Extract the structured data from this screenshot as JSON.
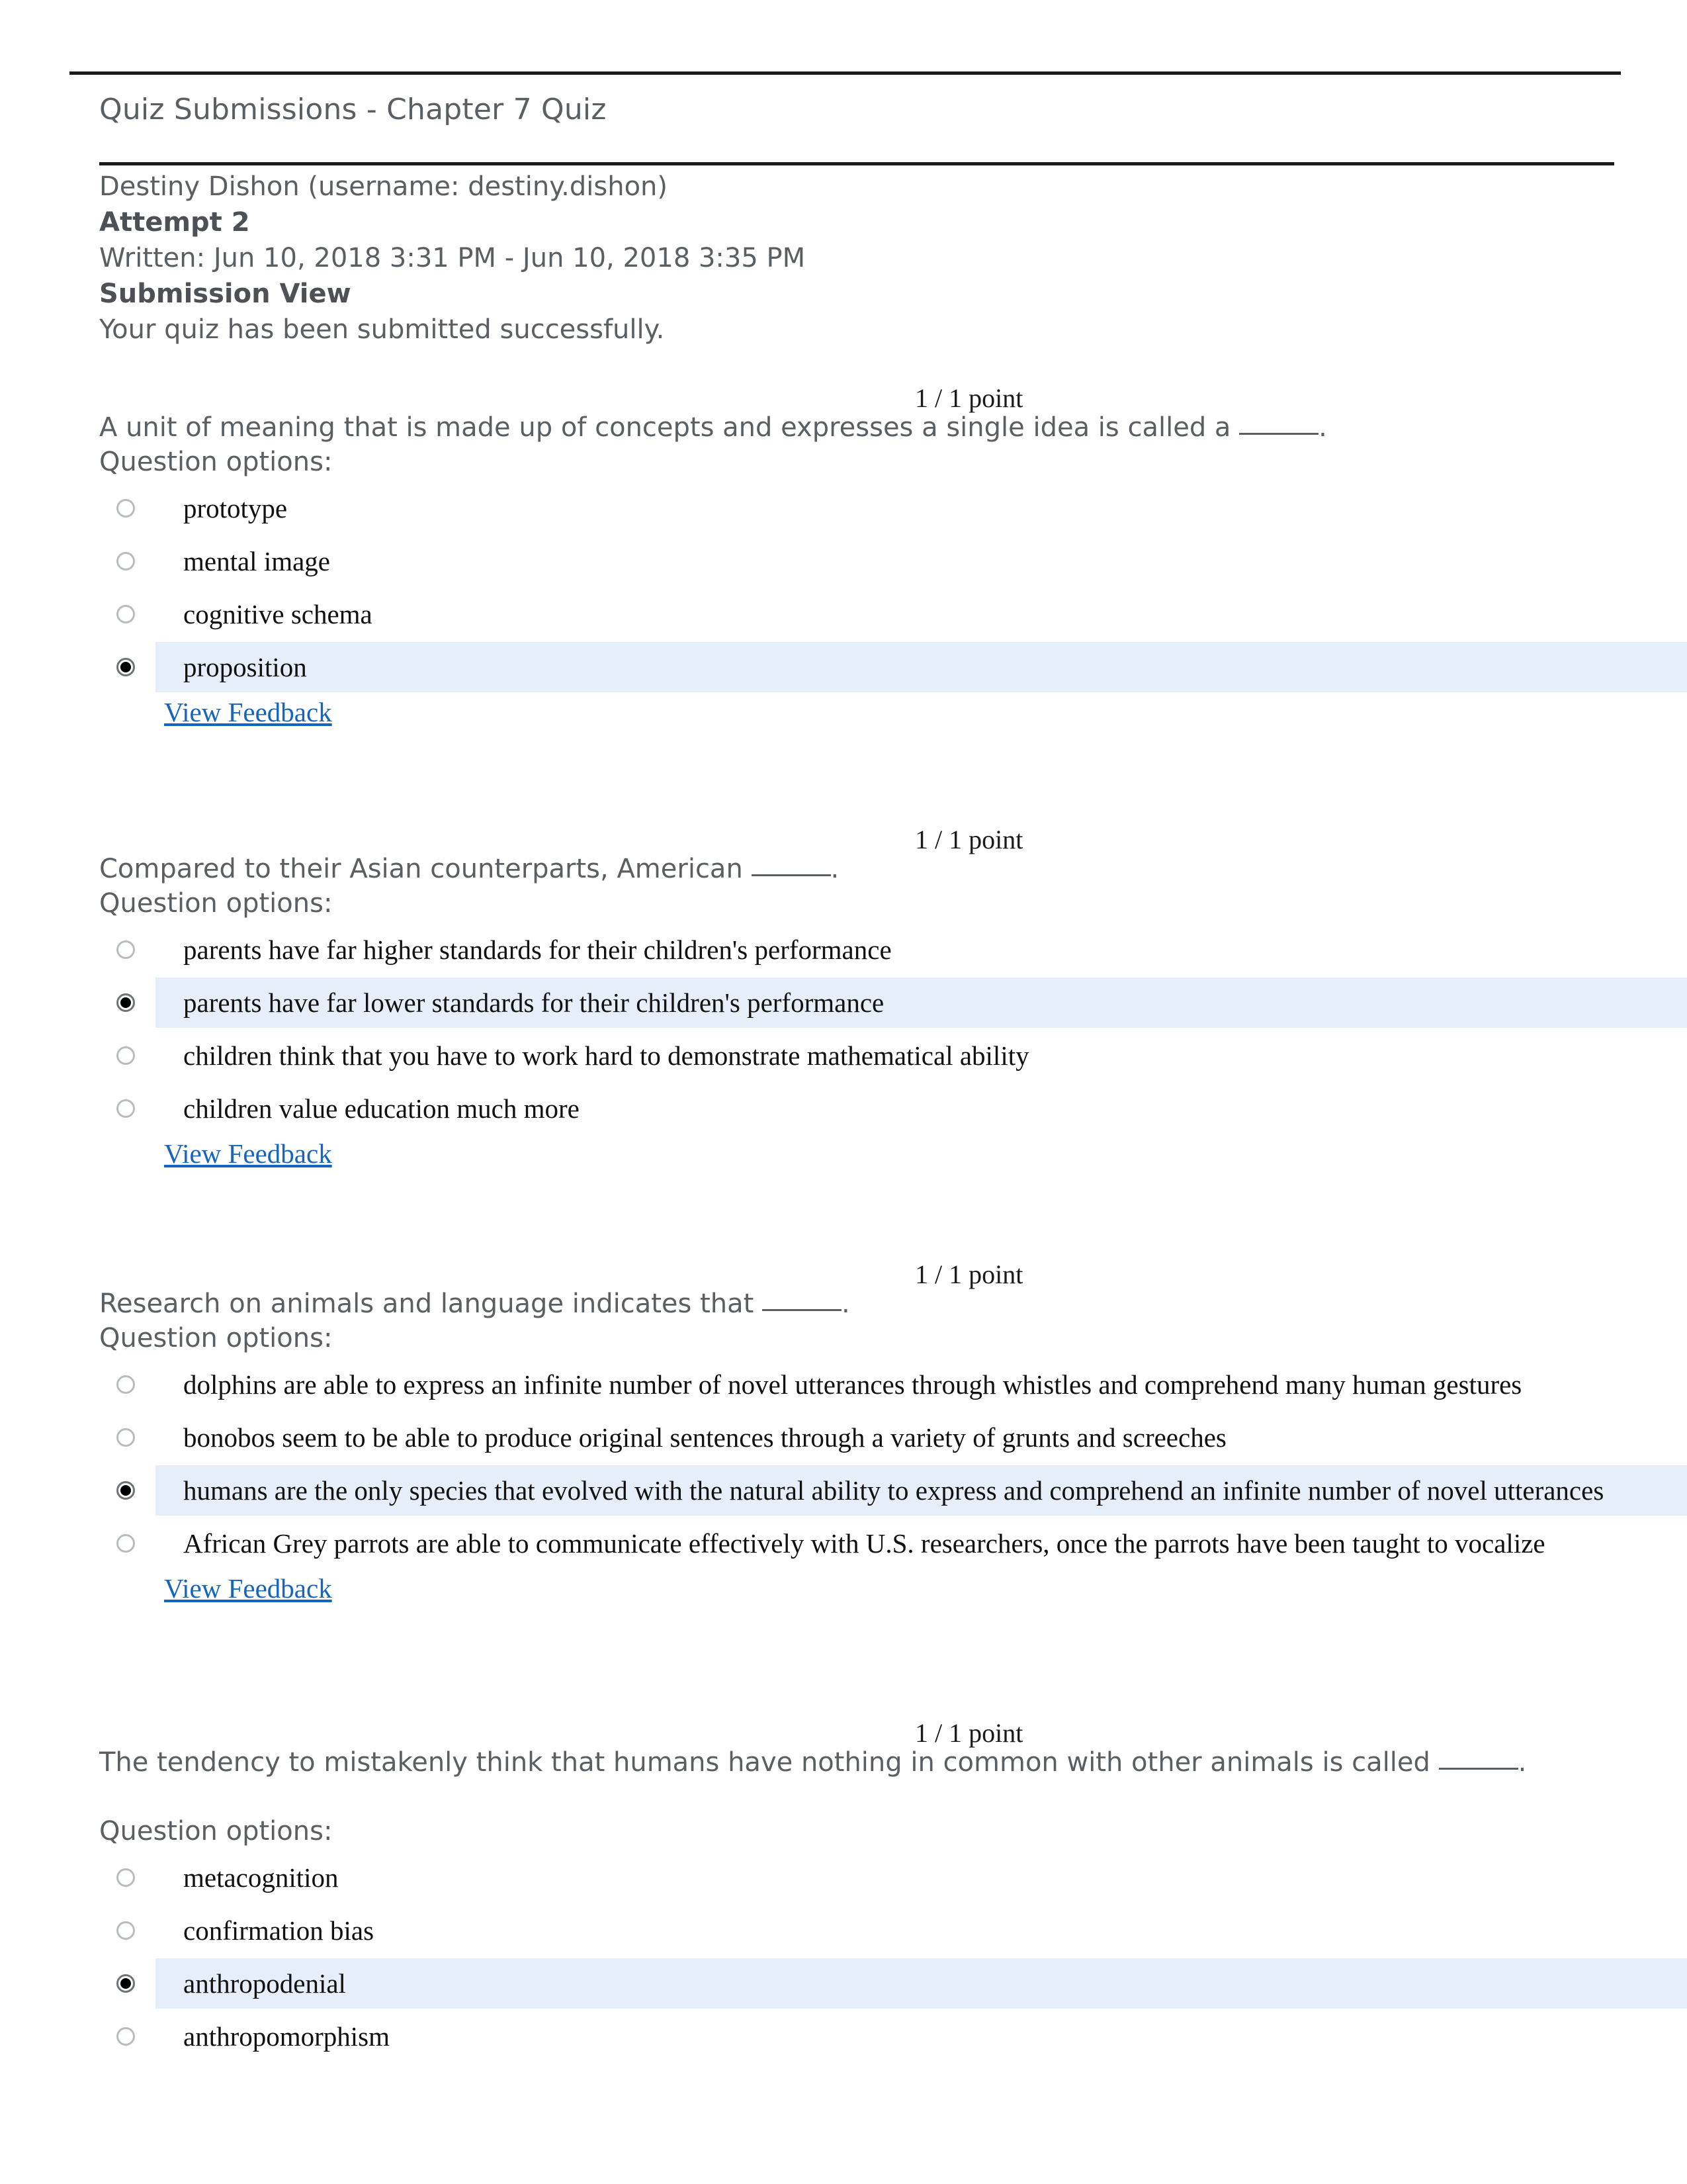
{
  "header": {
    "doc_title": "Quiz Submissions - Chapter 7 Quiz",
    "student": "Destiny Dishon (username: destiny.dishon)",
    "attempt": "Attempt 2",
    "written": "Written: Jun 10, 2018 3:31 PM - Jun 10, 2018 3:35 PM",
    "submission_view": "Submission View",
    "status_message": "Your quiz has been submitted successfully."
  },
  "labels": {
    "question_options": "Question options:",
    "view_feedback": "View Feedback"
  },
  "colors": {
    "selected_row": "#e6eff9",
    "link": "#1565c0",
    "body_text": "#5b5f62",
    "option_text": "#111111"
  },
  "questions": [
    {
      "points": "1 / 1 point",
      "text_before_blank": "A unit of meaning that is made up of concepts and expresses a single idea is called a ",
      "text_after_blank": ".",
      "options": [
        {
          "label": "prototype",
          "selected": false
        },
        {
          "label": "mental image",
          "selected": false
        },
        {
          "label": "cognitive schema",
          "selected": false
        },
        {
          "label": "proposition",
          "selected": true
        }
      ],
      "has_feedback_link": true
    },
    {
      "points": "1 / 1 point",
      "text_before_blank": "Compared to their Asian counterparts, American ",
      "text_after_blank": ".",
      "options": [
        {
          "label": "parents have far higher standards for their children's performance",
          "selected": false
        },
        {
          "label": "parents have far lower standards for their children's performance",
          "selected": true
        },
        {
          "label": "children think that you have to work hard to demonstrate mathematical ability",
          "selected": false
        },
        {
          "label": "children value education much more",
          "selected": false
        }
      ],
      "has_feedback_link": true
    },
    {
      "points": "1 / 1 point",
      "text_before_blank": "Research on animals and language indicates that ",
      "text_after_blank": ".",
      "options": [
        {
          "label": "dolphins are able to express an infinite number of novel utterances through whistles and comprehend many human gestures",
          "selected": false
        },
        {
          "label": "bonobos seem to be able to produce original sentences through a variety of grunts and screeches",
          "selected": false
        },
        {
          "label": "humans are the only species that evolved with the natural ability to express and comprehend an infinite number of novel utterances",
          "selected": true
        },
        {
          "label": "African Grey parrots are able to communicate effectively with U.S. researchers, once the parrots have been taught to vocalize",
          "selected": false
        }
      ],
      "has_feedback_link": true
    },
    {
      "points": "1 / 1 point",
      "text_before_blank": "The tendency to mistakenly think that humans have nothing in common with other animals is called ",
      "text_after_blank": ".",
      "options": [
        {
          "label": "metacognition",
          "selected": false
        },
        {
          "label": "confirmation bias",
          "selected": false
        },
        {
          "label": "anthropodenial",
          "selected": true
        },
        {
          "label": "anthropomorphism",
          "selected": false
        }
      ],
      "has_feedback_link": false
    }
  ]
}
